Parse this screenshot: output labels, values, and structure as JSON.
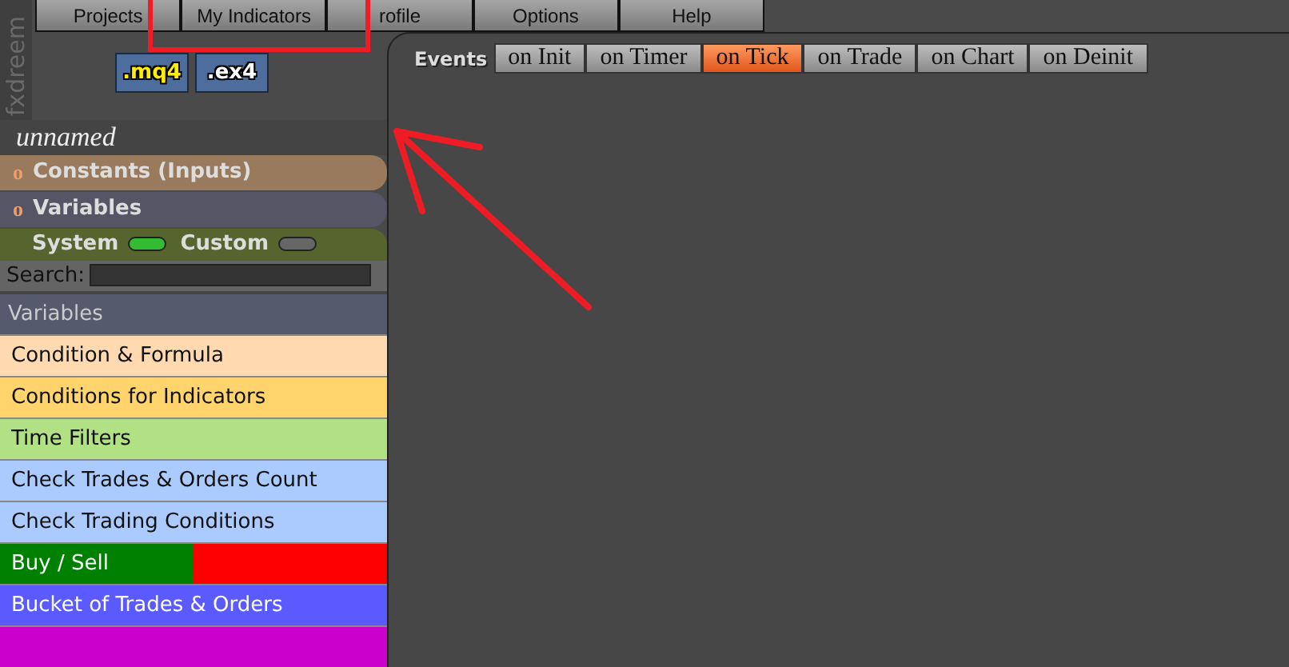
{
  "logo": {
    "text": "fxdreem"
  },
  "menu": [
    "Projects",
    "My Indicators",
    "rofile",
    "Options",
    "Help"
  ],
  "export_buttons": [
    {
      "label": ".mq4",
      "kind": "source"
    },
    {
      "label": ".ex4",
      "kind": "compiled"
    }
  ],
  "project": {
    "name": "unnamed"
  },
  "sections": [
    {
      "bullet": "o",
      "label": "Constants (Inputs)",
      "color": "#9a7a5c"
    },
    {
      "bullet": "o",
      "label": "Variables",
      "color": "#555566"
    }
  ],
  "toggles": [
    {
      "label": "System",
      "on": true
    },
    {
      "label": "Custom",
      "on": false
    }
  ],
  "search": {
    "label": "Search:"
  },
  "palette_header": "Variables",
  "palette": [
    {
      "label": "Condition & Formula",
      "color": "#ffdab0"
    },
    {
      "label": "Conditions for Indicators",
      "color": "#ffd46c"
    },
    {
      "label": "Time Filters",
      "color": "#b2e084"
    },
    {
      "label": "Check Trades & Orders Count",
      "color": "#abcbff"
    },
    {
      "label": "Check Trading Conditions",
      "color": "#abcbff"
    },
    {
      "label": "Buy / Sell",
      "color": "#008000",
      "end_block": {
        "color": "#ff0000"
      }
    },
    {
      "label": "Bucket of Trades & Orders",
      "color": "#5a5aff"
    },
    {
      "color": "#cc00cc"
    }
  ],
  "events": {
    "label": "Events",
    "tabs": [
      {
        "label": "on Init",
        "selected": false
      },
      {
        "label": "on Timer",
        "selected": false
      },
      {
        "label": "on Tick",
        "selected": true
      },
      {
        "label": "on Trade",
        "selected": false
      },
      {
        "label": "on Chart",
        "selected": false
      },
      {
        "label": "on Deinit",
        "selected": false
      }
    ]
  },
  "annotations": [
    {
      "kind": "rectangle",
      "color": "#ee1c24"
    },
    {
      "kind": "arrow",
      "color": "#ee1c24"
    }
  ]
}
